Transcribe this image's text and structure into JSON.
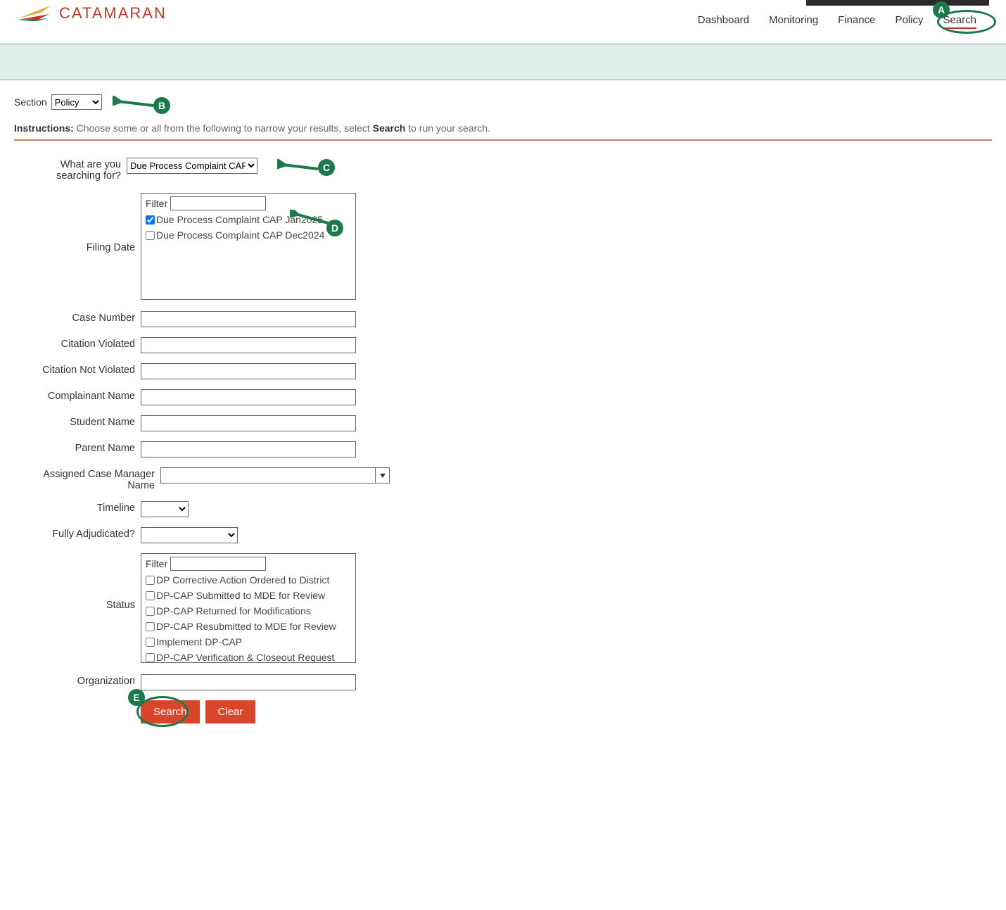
{
  "brand": {
    "name": "CATAMARAN"
  },
  "nav": {
    "dashboard": "Dashboard",
    "monitoring": "Monitoring",
    "finance": "Finance",
    "policy": "Policy",
    "search": "Search"
  },
  "section": {
    "label": "Section",
    "value": "Policy"
  },
  "instructions": {
    "label": "Instructions:",
    "text_pre": " Choose some or all from the following to narrow your results, select ",
    "strong": "Search",
    "text_post": " to run your search."
  },
  "search_for": {
    "label": "What are you searching for?",
    "value": "Due Process Complaint CAP"
  },
  "filing_date": {
    "label": "Filing Date",
    "filter_label": "Filter",
    "options": [
      {
        "label": "Due Process Complaint CAP Jan2025",
        "checked": true
      },
      {
        "label": "Due Process Complaint CAP Dec2024",
        "checked": false
      }
    ]
  },
  "fields": {
    "case_number": "Case Number",
    "citation_violated": "Citation Violated",
    "citation_not_violated": "Citation Not Violated",
    "complainant_name": "Complainant Name",
    "student_name": "Student Name",
    "parent_name": "Parent Name",
    "assigned_cm": "Assigned Case Manager Name",
    "timeline": "Timeline",
    "fully_adjudicated": "Fully Adjudicated?",
    "organization": "Organization"
  },
  "status": {
    "label": "Status",
    "filter_label": "Filter",
    "options": [
      "DP Corrective Action Ordered to District",
      "DP-CAP Submitted to MDE for Review",
      "DP-CAP Returned for Modifications",
      "DP-CAP Resubmitted to MDE for Review",
      "Implement DP-CAP",
      "DP-CAP Verification & Closeout Request Submitted"
    ]
  },
  "buttons": {
    "search": "Search",
    "clear": "Clear"
  },
  "annotations": {
    "A": "A",
    "B": "B",
    "C": "C",
    "D": "D",
    "E": "E"
  }
}
